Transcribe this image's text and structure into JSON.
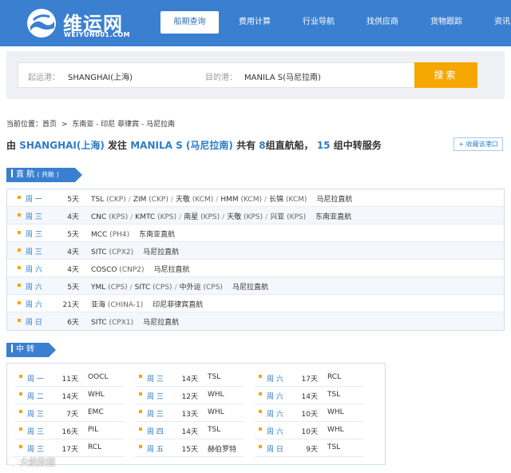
{
  "header": {
    "logo_cn": "维运网",
    "logo_en": "WEIYUN001.COM",
    "nav": [
      "船期查询",
      "费用计算",
      "行业导航",
      "找供应商",
      "货物跟踪",
      "资讯"
    ]
  },
  "search": {
    "origin_label": "起运港：",
    "origin_value": "SHANGHAI(上海)",
    "dest_label": "目的港：",
    "dest_value": "MANILA S(马尼拉南)",
    "button": "搜索"
  },
  "breadcrumb": [
    "当前位置：首页",
    ">",
    "东南亚 - 印尼 菲律宾 - 马尼拉南"
  ],
  "summary": {
    "p1": "由",
    "origin": "SHANGHAI(上海)",
    "p2": "发往",
    "dest": "MANILA S (马尼拉南)",
    "p3": "共有",
    "direct_count": "8",
    "p4": "组直航船，",
    "transfer_count": "15",
    "p5": "组中转服务"
  },
  "favorite_button": "+ 收藏该港口",
  "direct": {
    "label": "直 航",
    "sublabel": "( 共舱 )",
    "rows": [
      {
        "day": "周 一",
        "duration": "5天",
        "route": [
          {
            "carrier": "TSL",
            "code": "(CKP)"
          },
          {
            "carrier": "ZIM",
            "code": "(CKP)"
          },
          {
            "carrier": "天敬",
            "code": "(KCM)"
          },
          {
            "carrier": "HMM",
            "code": "(KCM)"
          },
          {
            "carrier": "长锦",
            "code": "(KCM)"
          }
        ],
        "type": "马尼拉直航"
      },
      {
        "day": "周 三",
        "duration": "4天",
        "route": [
          {
            "carrier": "CNC",
            "code": "(KPS)"
          },
          {
            "carrier": "KMTC",
            "code": "(KPS)"
          },
          {
            "carrier": "南星",
            "code": "(KPS)"
          },
          {
            "carrier": "天敬",
            "code": "(KPS)"
          },
          {
            "carrier": "兴亚",
            "code": "(KPS)"
          }
        ],
        "type": "东南亚直航"
      },
      {
        "day": "周 三",
        "duration": "5天",
        "route": [
          {
            "carrier": "MCC",
            "code": "(PH4)"
          }
        ],
        "type": "东南亚直航"
      },
      {
        "day": "周 三",
        "duration": "4天",
        "route": [
          {
            "carrier": "SITC",
            "code": "(CPX2)"
          }
        ],
        "type": "马尼拉直航"
      },
      {
        "day": "周 六",
        "duration": "4天",
        "route": [
          {
            "carrier": "COSCO",
            "code": "(CNP2)"
          }
        ],
        "type": "马尼拉直航"
      },
      {
        "day": "周 六",
        "duration": "5天",
        "route": [
          {
            "carrier": "YML",
            "code": "(CPS)"
          },
          {
            "carrier": "SITC",
            "code": "(CPS)"
          },
          {
            "carrier": "中外运",
            "code": "(CPS)"
          }
        ],
        "type": "马尼拉直航"
      },
      {
        "day": "周 六",
        "duration": "21天",
        "route": [
          {
            "carrier": "亚海",
            "code": "(CHINA-1)"
          }
        ],
        "type": "印尼菲律宾直航"
      },
      {
        "day": "周 日",
        "duration": "6天",
        "route": [
          {
            "carrier": "SITC",
            "code": "(CPX1)"
          }
        ],
        "type": "马尼拉直航"
      }
    ]
  },
  "transfer": {
    "label": "中 转",
    "columns": [
      [
        {
          "day": "周 一",
          "duration": "11天",
          "carrier": "OOCL"
        },
        {
          "day": "周 二",
          "duration": "14天",
          "carrier": "WHL"
        },
        {
          "day": "周 三",
          "duration": "7天",
          "carrier": "EMC"
        },
        {
          "day": "周 三",
          "duration": "16天",
          "carrier": "PIL"
        },
        {
          "day": "周 三",
          "duration": "17天",
          "carrier": "RCL"
        }
      ],
      [
        {
          "day": "周 三",
          "duration": "14天",
          "carrier": "TSL"
        },
        {
          "day": "周 三",
          "duration": "12天",
          "carrier": "WHL"
        },
        {
          "day": "周 三",
          "duration": "13天",
          "carrier": "WHL"
        },
        {
          "day": "周 四",
          "duration": "14天",
          "carrier": "TSL"
        },
        {
          "day": "周 五",
          "duration": "15天",
          "carrier": "赫伯罗特"
        }
      ],
      [
        {
          "day": "周 六",
          "duration": "17天",
          "carrier": "RCL"
        },
        {
          "day": "周 六",
          "duration": "14天",
          "carrier": "TSL"
        },
        {
          "day": "周 六",
          "duration": "10天",
          "carrier": "WHL"
        },
        {
          "day": "周 六",
          "duration": "10天",
          "carrier": "WHL"
        },
        {
          "day": "周 日",
          "duration": "9天",
          "carrier": "TSL"
        }
      ]
    ]
  },
  "watermark": "大航数据",
  "colors": {
    "brand_blue": "#3a7fd0",
    "link_blue": "#2e7cc9",
    "accent_orange": "#f5a700"
  }
}
